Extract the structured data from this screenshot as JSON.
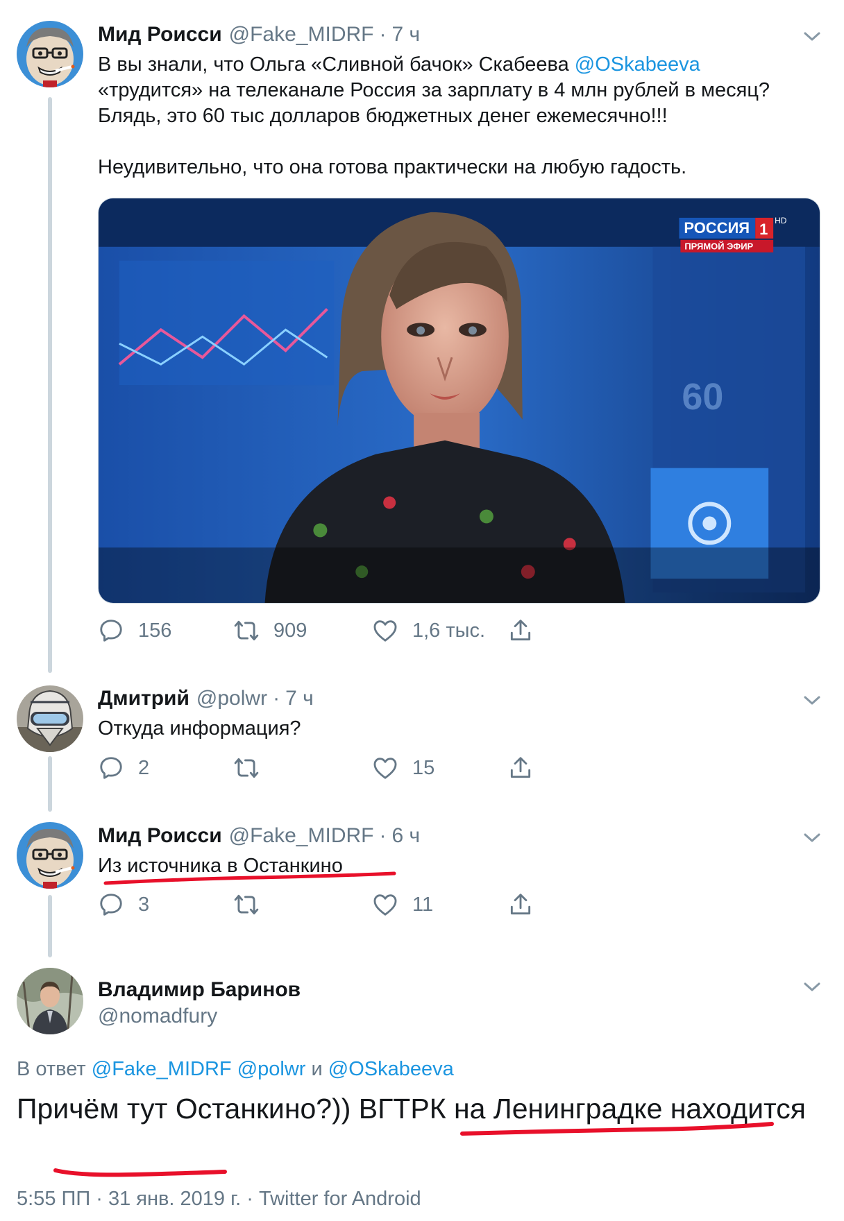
{
  "tweets": [
    {
      "name": "Мид Роисси",
      "handle": "@Fake_MIDRF",
      "dot": "·",
      "time": "7 ч",
      "text_line1_pre": "В вы знали, что Ольга «Сливной бачок» Скабеева ",
      "text_line1_mention": "@OSkabeeva",
      "text_line2": "«трудится» на телеканале Россия за зарплату в 4 млн рублей в месяц?",
      "text_line3": "Блядь, это 60 тыс долларов бюджетных денег ежемесячно!!!",
      "text_line4": "Неудивительно, что она готова практически на любую гадость.",
      "media": {
        "channel_logo": "РОССИЯ",
        "channel_number": "1",
        "channel_hd": "HD",
        "live_label": "ПРЯМОЙ ЭФИР",
        "screen_number": "60"
      },
      "replies": "156",
      "retweets": "909",
      "likes": "1,6 тыс."
    },
    {
      "name": "Дмитрий",
      "handle": "@polwr",
      "dot": "·",
      "time": "7 ч",
      "text": "Откуда информация?",
      "replies": "2",
      "retweets": "",
      "likes": "15"
    },
    {
      "name": "Мид Роисси",
      "handle": "@Fake_MIDRF",
      "dot": "·",
      "time": "6 ч",
      "text": "Из источника в Останкино",
      "replies": "3",
      "retweets": "",
      "likes": "11"
    }
  ],
  "main_tweet": {
    "name": "Владимир Баринов",
    "handle": "@nomadfury",
    "reply_prefix": "В ответ",
    "reply_mention1": "@Fake_MIDRF",
    "reply_mention2": "@polwr",
    "reply_and": "и",
    "reply_mention3": "@OSkabeeva",
    "text": "Причём тут Останкино?)) ВГТРК на Ленинградке находится",
    "meta": "5:55 ПП · 31 янв. 2019 г. · Twitter for Android"
  },
  "icons": {
    "reply": "reply-icon",
    "retweet": "retweet-icon",
    "like": "heart-icon",
    "share": "share-icon",
    "menu": "chevron-down-icon"
  },
  "colors": {
    "link": "#1b95e0",
    "secondary_text": "#657786",
    "thread_line": "#ccd6dd",
    "underline_marker": "#e8102a"
  }
}
